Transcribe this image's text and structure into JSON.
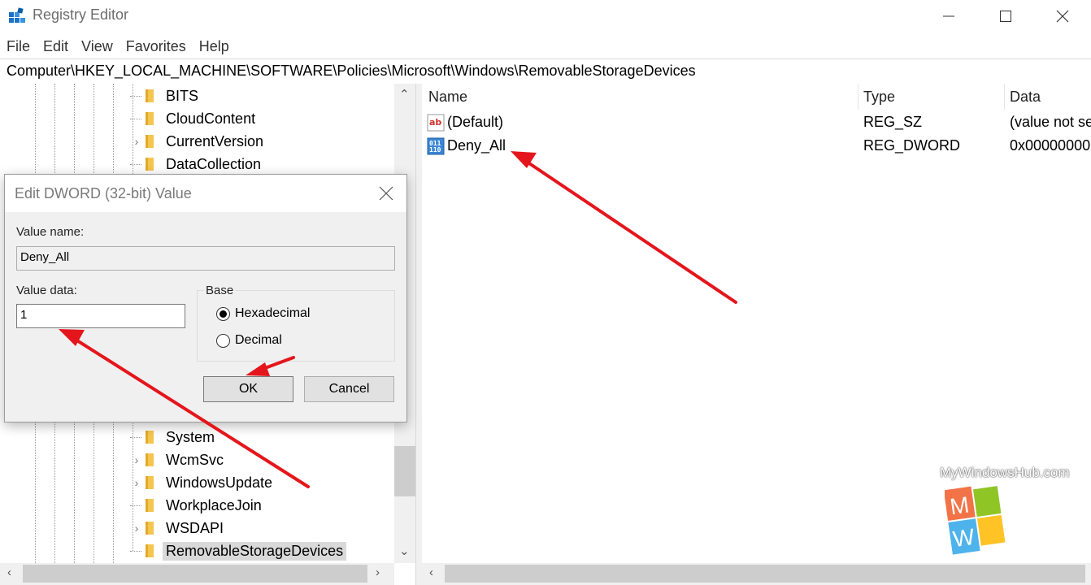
{
  "window": {
    "title": "Registry Editor",
    "minimize_glyph": "—",
    "maximize_glyph": "☐",
    "close_glyph": "✕"
  },
  "menu": [
    "File",
    "Edit",
    "View",
    "Favorites",
    "Help"
  ],
  "address": "Computer\\HKEY_LOCAL_MACHINE\\SOFTWARE\\Policies\\Microsoft\\Windows\\RemovableStorageDevices",
  "tree": {
    "items": [
      {
        "label": "BITS",
        "expandable": false
      },
      {
        "label": "CloudContent",
        "expandable": false
      },
      {
        "label": "CurrentVersion",
        "expandable": true
      },
      {
        "label": "DataCollection",
        "expandable": false
      },
      {
        "label": "System",
        "expandable": false
      },
      {
        "label": "WcmSvc",
        "expandable": true
      },
      {
        "label": "WindowsUpdate",
        "expandable": true
      },
      {
        "label": "WorkplaceJoin",
        "expandable": false
      },
      {
        "label": "WSDAPI",
        "expandable": true
      },
      {
        "label": "RemovableStorageDevices",
        "expandable": false,
        "selected": true
      }
    ]
  },
  "list": {
    "columns": [
      "Name",
      "Type",
      "Data"
    ],
    "rows": [
      {
        "name": "(Default)",
        "type": "REG_SZ",
        "data": "(value not se",
        "icon": "string-value-icon"
      },
      {
        "name": "Deny_All",
        "type": "REG_DWORD",
        "data": "0x00000000",
        "icon": "dword-value-icon"
      }
    ]
  },
  "dialog": {
    "title": "Edit DWORD (32-bit) Value",
    "value_name_label": "Value name:",
    "value_name": "Deny_All",
    "value_data_label": "Value data:",
    "value_data": "1",
    "base_label": "Base",
    "hex_label": "Hexadecimal",
    "dec_label": "Decimal",
    "selected_base": "Hexadecimal",
    "ok_label": "OK",
    "cancel_label": "Cancel"
  },
  "watermark": {
    "text": "MyWindowsHub.com",
    "logo_letter_top": "M",
    "logo_letter_bottom": "W"
  },
  "colors": {
    "arrow": "#e4161c",
    "folder": "#f4c64e",
    "selection": "#d9d9d9",
    "logo_orange": "#f05a28",
    "logo_green": "#7cbb00",
    "logo_blue": "#2fa6e8",
    "logo_yellow": "#ffb900"
  }
}
